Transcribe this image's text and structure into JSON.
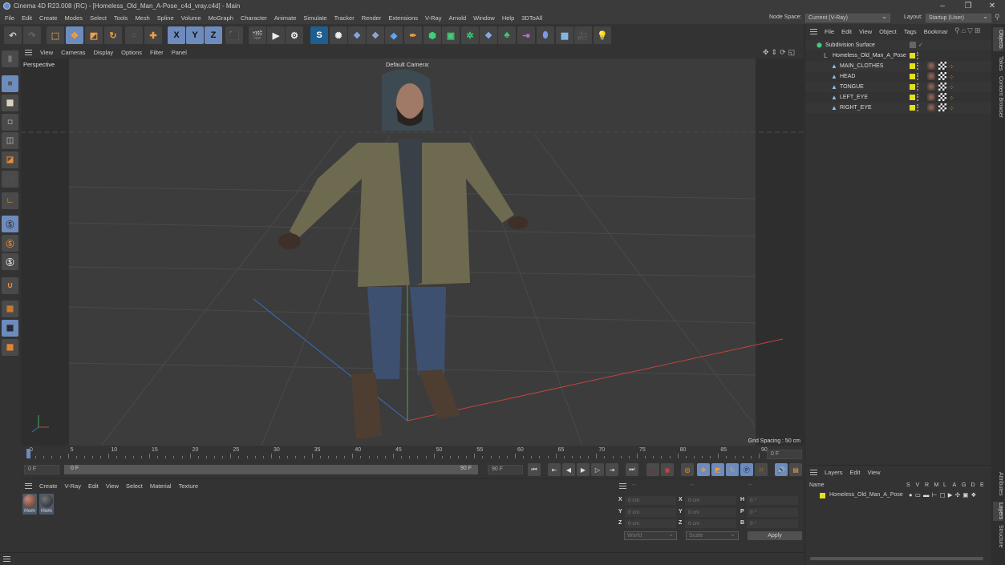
{
  "window": {
    "title": "Cinema 4D R23.008 (RC) - [Homeless_Old_Man_A-Pose_c4d_vray.c4d] - Main",
    "controls": [
      "–",
      "❐",
      "✕"
    ]
  },
  "menubar": {
    "items": [
      "File",
      "Edit",
      "Create",
      "Modes",
      "Select",
      "Tools",
      "Mesh",
      "Spline",
      "Volume",
      "MoGraph",
      "Character",
      "Animate",
      "Simulate",
      "Tracker",
      "Render",
      "Extensions",
      "V-Ray",
      "Arnold",
      "Window",
      "Help",
      "3DToAll"
    ],
    "node_space_label": "Node Space:",
    "node_space_value": "Current (V-Ray)",
    "layout_label": "Layout:",
    "layout_value": "Startup (User)"
  },
  "toolbar": {
    "axis_x": "X",
    "axis_y": "Y",
    "axis_z": "Z"
  },
  "viewport": {
    "menu": [
      "View",
      "Cameras",
      "Display",
      "Options",
      "Filter",
      "Panel"
    ],
    "view_name": "Perspective",
    "camera": "Default Camera:",
    "grid_spacing": "Grid Spacing : 50 cm"
  },
  "timeline": {
    "ticks": [
      "0",
      "5",
      "10",
      "15",
      "20",
      "25",
      "30",
      "35",
      "40",
      "45",
      "50",
      "55",
      "60",
      "65",
      "70",
      "75",
      "80",
      "85",
      "90"
    ],
    "current_frame_right": "0 F",
    "start_field": "0 F",
    "range_start": "0 F",
    "range_end": "90 F",
    "end_field": "90 F",
    "current_frame": 0,
    "max_frame": 90
  },
  "material_panel": {
    "menu": [
      "Create",
      "V-Ray",
      "Edit",
      "View",
      "Select",
      "Material",
      "Texture"
    ],
    "materials": [
      {
        "label": "Hom",
        "color": "#8a5a4e"
      },
      {
        "label": "Hom",
        "color": "#3a3e44"
      }
    ]
  },
  "coord_panel": {
    "headers": [
      "--",
      "--",
      "--"
    ],
    "rows": [
      {
        "a": "X",
        "av": "0 cm",
        "b": "X",
        "bv": "0 cm",
        "c": "H",
        "cv": "0 °"
      },
      {
        "a": "Y",
        "av": "0 cm",
        "b": "Y",
        "bv": "0 cm",
        "c": "P",
        "cv": "0 °"
      },
      {
        "a": "Z",
        "av": "0 cm",
        "b": "Z",
        "bv": "0 cm",
        "c": "B",
        "cv": "0 °"
      }
    ],
    "space": "World",
    "mode": "Scale",
    "apply": "Apply"
  },
  "object_panel": {
    "menu": [
      "File",
      "Edit",
      "View",
      "Object",
      "Tags",
      "Bookmar"
    ],
    "objects": [
      {
        "name": "Subdivision Surface",
        "type": "subdivision",
        "depth": 0
      },
      {
        "name": "Homeless_Old_Man_A_Pose",
        "type": "null",
        "depth": 1
      },
      {
        "name": "MAIN_CLOTHES",
        "type": "polygon",
        "depth": 2
      },
      {
        "name": "HEAD",
        "type": "polygon",
        "depth": 2
      },
      {
        "name": "TONGUE",
        "type": "polygon",
        "depth": 2
      },
      {
        "name": "LEFT_EYE",
        "type": "polygon",
        "depth": 2
      },
      {
        "name": "RIGHT_EYE",
        "type": "polygon",
        "depth": 2
      }
    ]
  },
  "right_tabs": [
    "Objects",
    "Takes",
    "Content Browser",
    "Attributes",
    "Layers",
    "Structure"
  ],
  "layer_panel": {
    "menu": [
      "Layers",
      "Edit",
      "View"
    ],
    "name_header": "Name",
    "columns": [
      "S",
      "V",
      "R",
      "M",
      "L",
      "A",
      "G",
      "D",
      "E"
    ],
    "layers": [
      {
        "name": "Homeless_Old_Man_A_Pose",
        "color": "#e3e020"
      }
    ]
  },
  "colors": {
    "accent": "#6d8bbd",
    "layer_yellow": "#e3e020",
    "x_axis": "#c0453a",
    "y_axis": "#3fae5a",
    "z_axis": "#3a6ec0"
  }
}
